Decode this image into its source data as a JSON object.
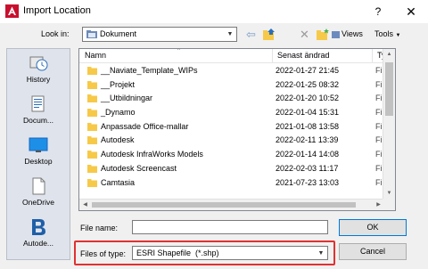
{
  "window": {
    "title": "Import Location",
    "help_label": "?",
    "close_label": "✕"
  },
  "lookin": {
    "label": "Look in:",
    "value": "Dokument"
  },
  "toolbar": {
    "views_label": "Views",
    "tools_label": "Tools"
  },
  "places": [
    {
      "label": "History",
      "icon": "history-icon"
    },
    {
      "label": "Docum...",
      "icon": "documents-icon"
    },
    {
      "label": "Desktop",
      "icon": "desktop-icon"
    },
    {
      "label": "OneDrive",
      "icon": "onedrive-icon"
    },
    {
      "label": "Autode...",
      "icon": "autodesk-icon"
    }
  ],
  "file_list": {
    "columns": [
      "Namn",
      "Senast ändrad",
      "Typ"
    ],
    "rows": [
      {
        "name": "__Naviate_Template_WIPs",
        "modified": "2022-01-27 21:45",
        "type": "Filma"
      },
      {
        "name": "__Projekt",
        "modified": "2022-01-25 08:32",
        "type": "Filma"
      },
      {
        "name": "__Utbildningar",
        "modified": "2022-01-20 10:52",
        "type": "Filma"
      },
      {
        "name": "_Dynamo",
        "modified": "2022-01-04 15:31",
        "type": "Filma"
      },
      {
        "name": "Anpassade Office-mallar",
        "modified": "2021-01-08 13:58",
        "type": "Filma"
      },
      {
        "name": "Autodesk",
        "modified": "2022-02-11 13:39",
        "type": "Filma"
      },
      {
        "name": "Autodesk InfraWorks Models",
        "modified": "2022-01-14 14:08",
        "type": "Filma"
      },
      {
        "name": "Autodesk Screencast",
        "modified": "2022-02-03 11:17",
        "type": "Filma"
      },
      {
        "name": "Camtasia",
        "modified": "2021-07-23 13:03",
        "type": "Filma"
      }
    ]
  },
  "filename": {
    "label": "File name:",
    "value": ""
  },
  "filetype": {
    "label": "Files of type:",
    "value": "ESRI Shapefile  (*.shp)"
  },
  "buttons": {
    "ok": "OK",
    "cancel": "Cancel"
  },
  "colors": {
    "folder": "#f7c948",
    "highlight": "#e03131",
    "accent": "#0078d7"
  }
}
